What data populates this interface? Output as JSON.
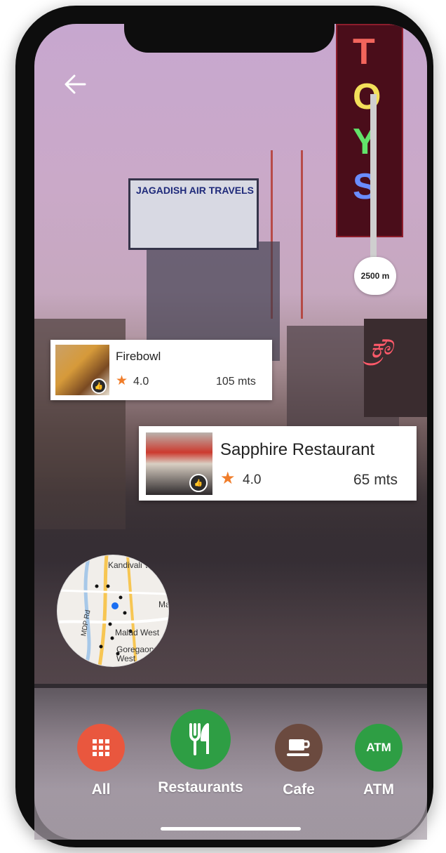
{
  "scene": {
    "billboard_text": "JAGADISH AIR TRAVELS",
    "sign_letters": [
      "T",
      "O",
      "Y",
      "S"
    ]
  },
  "distance_marker": {
    "label": "2500 m"
  },
  "places": [
    {
      "name": "Firebowl",
      "rating": "4.0",
      "distance": "105 mts"
    },
    {
      "name": "Sapphire Restaurant",
      "rating": "4.0",
      "distance": "65 mts"
    }
  ],
  "mini_map": {
    "labels": [
      "Kandivali West",
      "Mal",
      "Malad West",
      "Goregaon West",
      "MDP Rd"
    ]
  },
  "categories": [
    {
      "label": "All",
      "color": "#e9573e",
      "icon": "grid-icon"
    },
    {
      "label": "Restaurants",
      "color": "#2e9e44",
      "icon": "fork-knife-icon"
    },
    {
      "label": "Cafe",
      "color": "#6b4a3f",
      "icon": "coffee-cup-icon"
    },
    {
      "label": "ATM",
      "color": "#2e9e44",
      "icon": "atm-icon",
      "icon_text": "ATM"
    }
  ],
  "colors": {
    "star": "#f07d2a",
    "card_bg": "#ffffff"
  }
}
